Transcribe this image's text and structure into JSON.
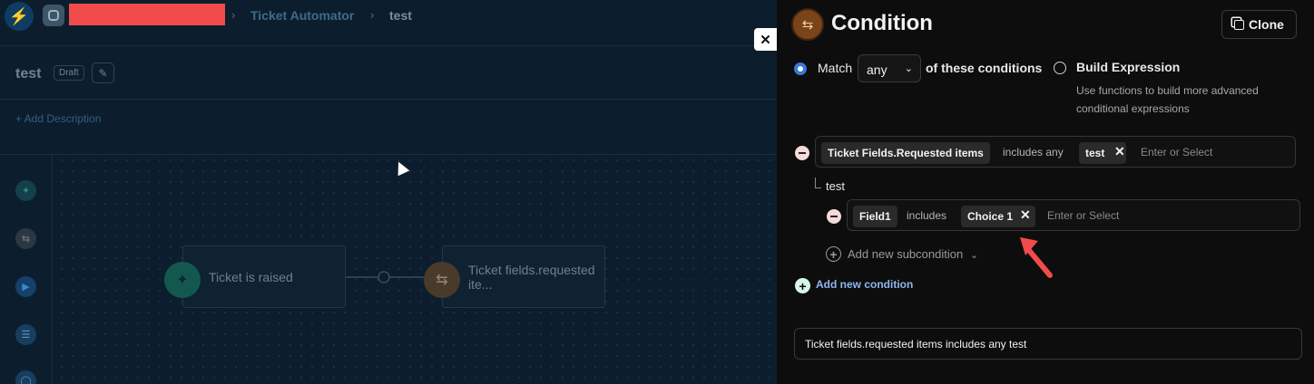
{
  "breadcrumb": {
    "items": [
      "Ticket Automator",
      "test"
    ]
  },
  "workflow": {
    "title": "test",
    "status_badge": "Draft",
    "add_description": "+ Add Description"
  },
  "canvas": {
    "nodes": [
      {
        "label": "Ticket is raised"
      },
      {
        "label": "Ticket fields.requested ite..."
      }
    ]
  },
  "panel": {
    "title": "Condition",
    "clone_label": "Clone",
    "match_label": "Match",
    "match_value": "any",
    "match_suffix": "of these conditions",
    "build_expression_label": "Build Expression",
    "build_expression_help": "Use functions to build more advanced conditional expressions",
    "condition": {
      "field": "Ticket Fields.Requested items",
      "operator": "includes any",
      "value_tag": "test",
      "placeholder": "Enter or Select"
    },
    "subgroup_label": "test",
    "subcondition": {
      "field": "Field1",
      "operator": "includes",
      "value_tag": "Choice 1",
      "placeholder": "Enter or Select"
    },
    "add_subcondition": "Add new subcondition",
    "add_condition": "Add new condition",
    "summary": "Ticket fields.requested items includes any test"
  },
  "colors": {
    "accent_blue": "#3a78d6",
    "link_blue": "#8fb6f0",
    "annotation_red": "#f24b4b",
    "panel_bg": "#0d0d0d"
  }
}
